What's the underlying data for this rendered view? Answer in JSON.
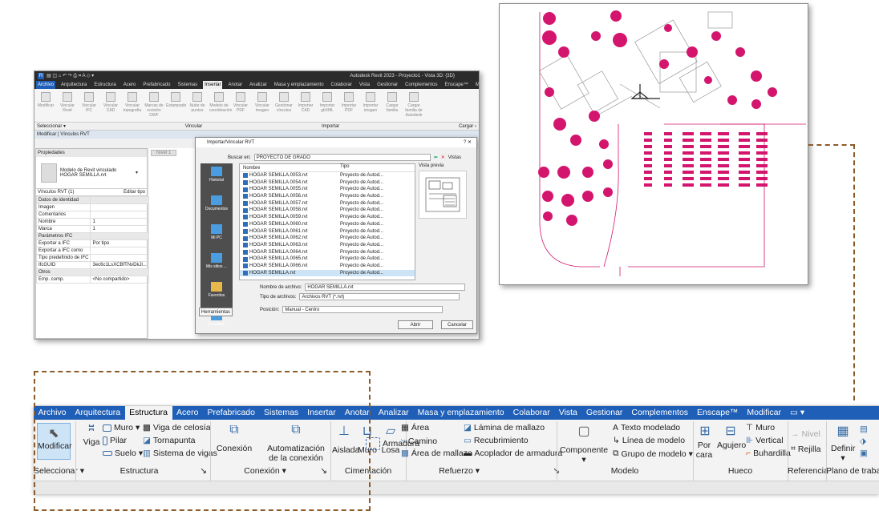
{
  "revit": {
    "title_bar": "Autodesk Revit 2023 - Proyecto1 - Vista 3D: {3D}",
    "tabs": [
      "Archivo",
      "Arquitectura",
      "Estructura",
      "Acero",
      "Prefabricado",
      "Sistemas",
      "Insertar",
      "Anotar",
      "Analizar",
      "Masa y emplazamiento",
      "Colaborar",
      "Vista",
      "Gestionar",
      "Complementos",
      "Enscape™",
      "Mo"
    ],
    "ribbon_buttons": [
      "Modificar",
      "Vincular Revit",
      "Vincular IFC",
      "Vincular CAD",
      "Vincular topografía",
      "Marcas de revisión DWF",
      "Estampado",
      "Nube de puntos",
      "Modelo de coordinación",
      "Vincular PDF",
      "Vincular imagen",
      "Gestionar vínculos",
      "Importar CAD",
      "Importar gbXML",
      "Importar PDF",
      "Importar imagen",
      "Cargar familia",
      "Cargar familia de Autodesk"
    ],
    "panel_seleccionar": "Seleccionar ▾",
    "panel_vincular": "Vincular",
    "panel_importar": "Importar",
    "panel_cargar": "Cargar ‹",
    "context_bar": "Modificar | Vínculos RVT",
    "properties": {
      "header": "Propiedades",
      "type_name": "Modelo de Revit vinculado HOGAR SEMILLA.rvt",
      "selector": "Vínculos RVT (1)",
      "edit_type": "Editar tipo",
      "rows": [
        {
          "sec": true,
          "k": "Datos de identidad",
          "v": ""
        },
        {
          "k": "Imagen",
          "v": ""
        },
        {
          "k": "Comentarios",
          "v": ""
        },
        {
          "k": "Nombre",
          "v": "1"
        },
        {
          "k": "Marca",
          "v": "1"
        },
        {
          "sec": true,
          "k": "Parámetros IFC",
          "v": ""
        },
        {
          "k": "Exportar a IFC",
          "v": "Por tipo"
        },
        {
          "k": "Exportar a IFC como",
          "v": ""
        },
        {
          "k": "Tipo predefinido de IFC",
          "v": ""
        },
        {
          "k": "IfcGUID",
          "v": "3ec6c1LsXCBfTNvDkJl..."
        },
        {
          "sec": true,
          "k": "Otros",
          "v": ""
        },
        {
          "k": "Emp. comp.",
          "v": "<No compartido>"
        }
      ]
    },
    "view_tab": "Nivel 1",
    "dialog": {
      "title": "Importar/Vincular RVT",
      "buscar_label": "Buscar en:",
      "folder": "PROYECTO DE GRADO",
      "vistas": "Vistas",
      "vista_previa": "Vista previa",
      "col_nombre": "Nombre",
      "col_tipo": "Tipo",
      "nav": [
        "Historial",
        "Documentos",
        "Mi PC",
        "Mis sitios ...",
        "Favoritos",
        "Escritorio"
      ],
      "files": [
        {
          "n": "HOGAR SEMILLA.0053.rvt",
          "t": "Proyecto de Autod..."
        },
        {
          "n": "HOGAR SEMILLA.0054.rvt",
          "t": "Proyecto de Autod..."
        },
        {
          "n": "HOGAR SEMILLA.0055.rvt",
          "t": "Proyecto de Autod..."
        },
        {
          "n": "HOGAR SEMILLA.0056.rvt",
          "t": "Proyecto de Autod..."
        },
        {
          "n": "HOGAR SEMILLA.0057.rvt",
          "t": "Proyecto de Autod..."
        },
        {
          "n": "HOGAR SEMILLA.0058.rvt",
          "t": "Proyecto de Autod..."
        },
        {
          "n": "HOGAR SEMILLA.0059.rvt",
          "t": "Proyecto de Autod..."
        },
        {
          "n": "HOGAR SEMILLA.0060.rvt",
          "t": "Proyecto de Autod..."
        },
        {
          "n": "HOGAR SEMILLA.0061.rvt",
          "t": "Proyecto de Autod..."
        },
        {
          "n": "HOGAR SEMILLA.0062.rvt",
          "t": "Proyecto de Autod..."
        },
        {
          "n": "HOGAR SEMILLA.0063.rvt",
          "t": "Proyecto de Autod..."
        },
        {
          "n": "HOGAR SEMILLA.0064.rvt",
          "t": "Proyecto de Autod..."
        },
        {
          "n": "HOGAR SEMILLA.0065.rvt",
          "t": "Proyecto de Autod..."
        },
        {
          "n": "HOGAR SEMILLA.0066.rvt",
          "t": "Proyecto de Autod..."
        },
        {
          "n": "HOGAR SEMILLA.rvt",
          "t": "Proyecto de Autod...",
          "selected": true
        }
      ],
      "nombre_label": "Nombre de archivo:",
      "nombre_value": "HOGAR SEMILLA.rvt",
      "tipo_label": "Tipo de archivos:",
      "tipo_value": "Archivos RVT  (*.rvt)",
      "posicion_label": "Posición:",
      "posicion_value": "Manual - Centro",
      "herramientas": "Herramientas",
      "abrir": "Abrir",
      "cancelar": "Cancelar"
    }
  },
  "ribbon2": {
    "tabs": [
      "Archivo",
      "Arquitectura",
      "Estructura",
      "Acero",
      "Prefabricado",
      "Sistemas",
      "Insertar",
      "Anotar",
      "Analizar",
      "Masa y emplazamiento",
      "Colaborar",
      "Vista",
      "Gestionar",
      "Complementos",
      "Enscape™",
      "Modificar",
      "▭ ▾"
    ],
    "active_tab": "Estructura",
    "buttons": {
      "modificar": "Modificar",
      "viga": "Viga",
      "muro": "Muro",
      "pilar": "Pilar",
      "suelo": "Suelo",
      "viga_celosia": "Viga de celosía",
      "tornapunta": "Tornapunta",
      "sistema_vigas": "Sistema de vigas",
      "conexion": "Conexión",
      "automatizacion": "Automatización de la conexión",
      "aislada": "Aislada",
      "muro_cim": "Muro",
      "losa": "Losa",
      "armadura": "Armadura",
      "area": "Área",
      "camino": "Camino",
      "area_mallazo": "Área de mallazo",
      "lamina": "Lámina de mallazo",
      "recubrimiento": "Recubrimiento",
      "acoplador": "Acoplador de armadura",
      "componente": "Componente",
      "texto_modelado": "Texto modelado",
      "linea_modelo": "Línea de modelo",
      "grupo_modelo": "Grupo de modelo",
      "por_cara": "Por cara",
      "agujero": "Agujero",
      "muro_h": "Muro",
      "vertical": "Vertical",
      "buhardilla": "Buhardilla",
      "nivel": "Nivel",
      "rejilla": "Rejilla",
      "definir": "Definir"
    },
    "panels": {
      "seleccionar": "Seleccionar",
      "estructura": "Estructura",
      "conexion": "Conexión",
      "cimentacion": "Cimentación",
      "refuerzo": "Refuerzo",
      "modelo": "Modelo",
      "hueco": "Hueco",
      "referencia": "Referencia",
      "plano": "Plano de trabajo"
    },
    "colors": {
      "accent": "#1f5fb7",
      "plan": "#d4156e",
      "dash": "#8b5a2b"
    }
  }
}
